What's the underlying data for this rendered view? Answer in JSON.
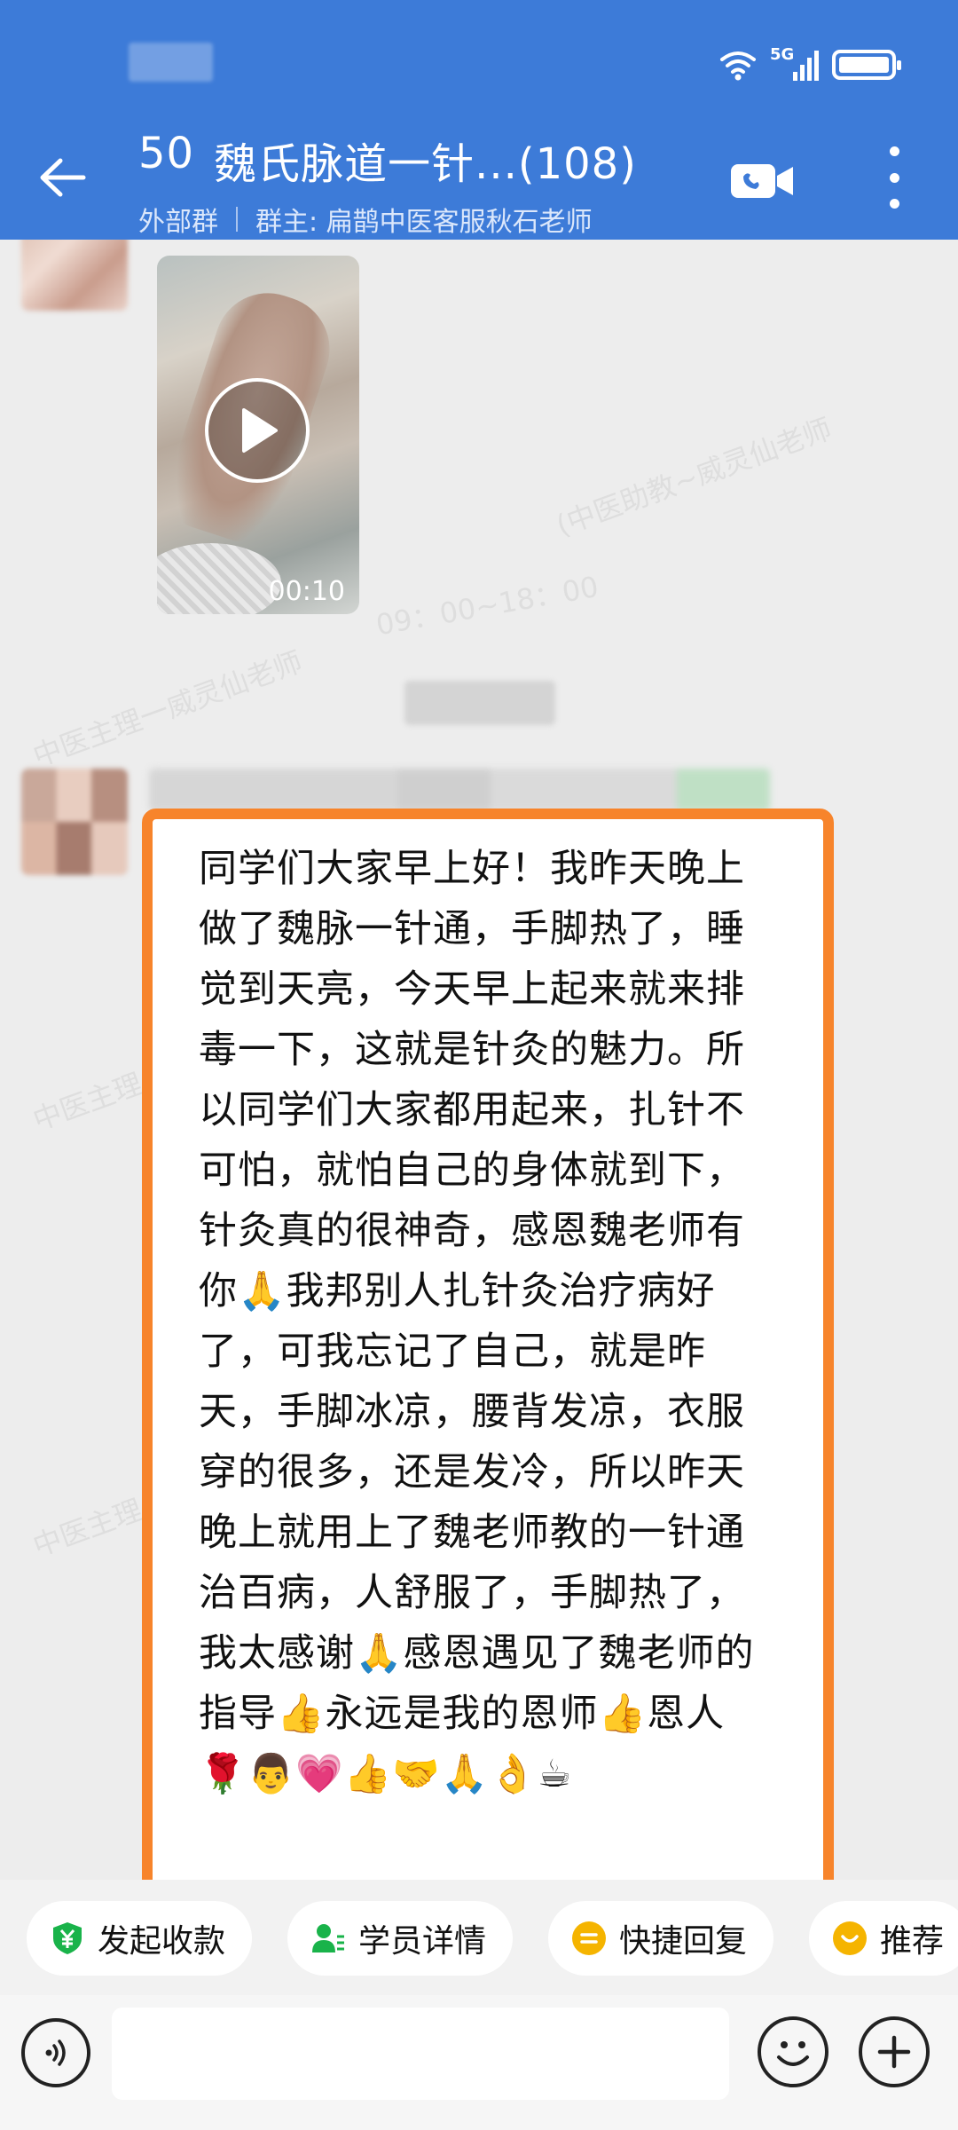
{
  "header": {
    "member_count_prefix": "50",
    "group_name": "魏氏脉道一针...(108)",
    "group_type": "外部群",
    "owner_label": "群主: 扁鹊中医客服秋石老师",
    "network": "5G",
    "background_color": "#3d7bd8"
  },
  "icons": {
    "back": "back-arrow-icon",
    "video_call": "video-camera-icon",
    "more": "more-vertical-icon",
    "wifi": "wifi-icon",
    "signal": "signal-icon",
    "battery": "battery-icon"
  },
  "watermarks": {
    "text_1": "中医主理一威灵仙老师",
    "text_2": "(中医助教~威灵仙老师",
    "text_3": "09：00~18：00",
    "text_4": "中医主理"
  },
  "messages": [
    {
      "type": "video",
      "duration": "00:10"
    },
    {
      "type": "text",
      "text": "同学们大家早上好！我昨天晚上做了魏脉一针通，手脚热了，睡觉到天亮，今天早上起来就来排毒一下，这就是针灸的魅力。所以同学们大家都用起来，扎针不可怕，就怕自己的身体就到下，针灸真的很神奇，感恩魏老师有你🙏我邦别人扎针灸治疗病好了，可我忘记了自己，就是昨天，手脚冰凉，腰背发凉，衣服穿的很多，还是发冷，所以昨天晚上就用上了魏老师教的一针通治百病，人舒服了，手脚热了，我太感谢🙏感恩遇见了魏老师的指导👍永远是我的恩师👍恩人🌹👨💗👍🤝🙏👌☕",
      "highlight_color": "#f7842b"
    }
  ],
  "quick_actions": [
    {
      "label": "发起收款",
      "icon": "payment-yuan-icon",
      "color": "#19b34a"
    },
    {
      "label": "学员详情",
      "icon": "student-profile-icon",
      "color": "#19b34a"
    },
    {
      "label": "快捷回复",
      "icon": "quick-reply-icon",
      "color": "#f5b400"
    },
    {
      "label": "推荐",
      "icon": "recommend-icon",
      "color": "#f5b400"
    }
  ],
  "input": {
    "placeholder": ""
  }
}
